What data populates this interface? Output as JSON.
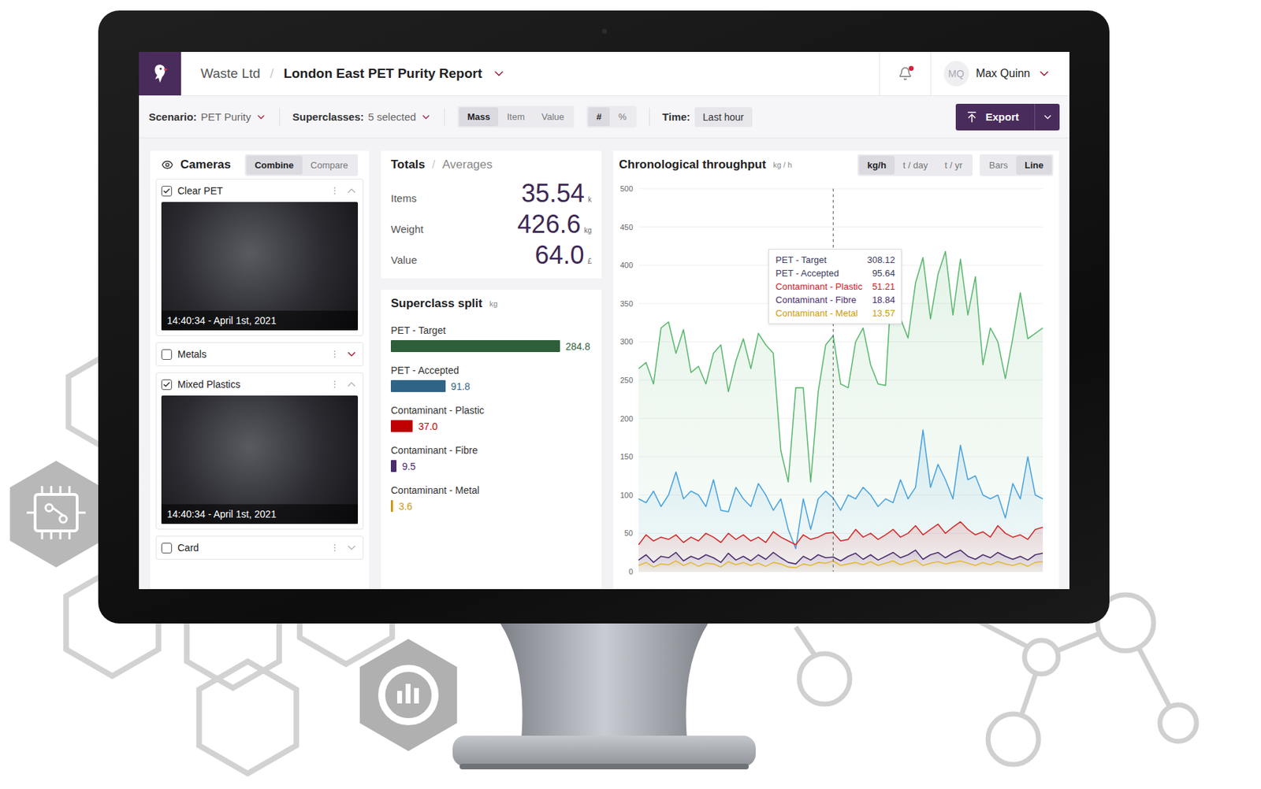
{
  "app": {
    "company": "Waste Ltd",
    "separator": "/",
    "report": "London East PET Purity Report"
  },
  "user": {
    "initials": "MQ",
    "name": "Max Quinn",
    "notifications": true
  },
  "toolbar": {
    "scenario": {
      "label": "Scenario:",
      "value": "PET Purity"
    },
    "superclasses": {
      "label": "Superclasses:",
      "value": "5 selected"
    },
    "measure": [
      {
        "label": "Mass",
        "selected": true
      },
      {
        "label": "Item",
        "selected": false
      },
      {
        "label": "Value",
        "selected": false
      }
    ],
    "unit": [
      {
        "label": "#",
        "selected": true
      },
      {
        "label": "%",
        "selected": false
      }
    ],
    "time": {
      "label": "Time:",
      "value": "Last hour"
    },
    "export": "Export"
  },
  "cameras": {
    "title": "Cameras",
    "modes": [
      {
        "label": "Combine",
        "selected": true
      },
      {
        "label": "Compare",
        "selected": false
      }
    ],
    "items": [
      {
        "name": "Clear PET",
        "checked": true,
        "expanded": true,
        "hovered": false,
        "timestamp": "14:40:34 - April 1st, 2021"
      },
      {
        "name": "Metals",
        "checked": false,
        "expanded": false,
        "hovered": true
      },
      {
        "name": "Mixed Plastics",
        "checked": true,
        "expanded": true,
        "hovered": false,
        "timestamp": "14:40:34 - April 1st, 2021"
      },
      {
        "name": "Card",
        "checked": false,
        "expanded": false,
        "hovered": false
      }
    ]
  },
  "totals": {
    "tabs": [
      {
        "label": "Totals",
        "selected": true
      },
      {
        "label": "Averages",
        "selected": false
      }
    ],
    "separator": "/",
    "rows": [
      {
        "label": "Items",
        "value": "35.54",
        "unit": "k"
      },
      {
        "label": "Weight",
        "value": "426.6",
        "unit": "kg"
      },
      {
        "label": "Value",
        "value": "64.0",
        "unit": "£"
      }
    ]
  },
  "split": {
    "title": "Superclass split",
    "unit": "kg",
    "items": [
      {
        "label": "PET - Target",
        "value": "284.8",
        "level": 1,
        "color": "#2e5e3a"
      },
      {
        "label": "PET - Accepted",
        "value": "91.8",
        "level": 0.322,
        "color": "#2f6486"
      },
      {
        "label": "Contaminant - Plastic",
        "value": "37.0",
        "level": 0.13,
        "color": "#c00000"
      },
      {
        "label": "Contaminant - Fibre",
        "value": "9.5",
        "level": 0.033,
        "color": "#4b2c6e"
      },
      {
        "label": "Contaminant - Metal",
        "value": "3.6",
        "level": 0.013,
        "color": "#c99a12"
      }
    ]
  },
  "chart": {
    "title": "Chronological throughput",
    "unit": "kg / h",
    "scales": [
      {
        "label": "kg/h",
        "selected": true
      },
      {
        "label": "t / day",
        "selected": false
      },
      {
        "label": "t / yr",
        "selected": false
      }
    ],
    "types": [
      {
        "label": "Bars",
        "selected": false
      },
      {
        "label": "Line",
        "selected": true
      }
    ],
    "ticks": [
      "500",
      "450",
      "400",
      "350",
      "300",
      "250",
      "200",
      "150",
      "100",
      "50",
      "0"
    ],
    "hover_index": 26,
    "tooltip": [
      {
        "name": "PET - Target",
        "value": "308.12",
        "color": "#3b3b5c"
      },
      {
        "name": "PET - Accepted",
        "value": "95.64",
        "color": "#3b3b5c"
      },
      {
        "name": "Contaminant - Plastic",
        "value": "51.21",
        "color": "#c81e2a"
      },
      {
        "name": "Contaminant - Fibre",
        "value": "18.84",
        "color": "#4b2c6e"
      },
      {
        "name": "Contaminant - Metal",
        "value": "13.57",
        "color": "#c99a12"
      }
    ],
    "series": [
      {
        "name": "PET - Target",
        "color": "#5cb870",
        "values": [
          265,
          273,
          245,
          318,
          326,
          285,
          316,
          260,
          268,
          245,
          285,
          296,
          235,
          275,
          304,
          265,
          311,
          296,
          285,
          158,
          117,
          240,
          240,
          117,
          235,
          296,
          308,
          245,
          240,
          300,
          318,
          270,
          245,
          243,
          408,
          330,
          305,
          377,
          410,
          330,
          388,
          418,
          335,
          408,
          335,
          385,
          270,
          318,
          300,
          252,
          305,
          364,
          304,
          311,
          318
        ]
      },
      {
        "name": "PET - Accepted",
        "color": "#4aa3df",
        "values": [
          95,
          90,
          105,
          85,
          100,
          130,
          95,
          105,
          100,
          85,
          120,
          80,
          78,
          110,
          95,
          85,
          115,
          100,
          80,
          95,
          55,
          30,
          95,
          55,
          95,
          105,
          96,
          80,
          100,
          95,
          110,
          100,
          85,
          95,
          90,
          120,
          95,
          110,
          185,
          110,
          140,
          120,
          95,
          165,
          120,
          125,
          100,
          95,
          100,
          70,
          115,
          95,
          150,
          100,
          95
        ]
      },
      {
        "name": "Contaminant - Plastic",
        "color": "#d42a2a",
        "values": [
          35,
          48,
          40,
          45,
          42,
          48,
          38,
          45,
          40,
          50,
          45,
          38,
          50,
          42,
          48,
          40,
          45,
          38,
          52,
          45,
          40,
          35,
          48,
          42,
          45,
          50,
          51,
          40,
          42,
          55,
          45,
          50,
          42,
          48,
          55,
          45,
          50,
          60,
          48,
          55,
          62,
          50,
          58,
          65,
          55,
          48,
          52,
          45,
          60,
          50,
          45,
          48,
          42,
          55,
          58
        ]
      },
      {
        "name": "Contaminant - Fibre",
        "color": "#4b2c6e",
        "values": [
          15,
          22,
          12,
          20,
          18,
          25,
          14,
          20,
          16,
          22,
          18,
          12,
          24,
          15,
          20,
          14,
          22,
          16,
          25,
          18,
          12,
          10,
          20,
          15,
          22,
          18,
          19,
          14,
          20,
          24,
          16,
          22,
          15,
          20,
          25,
          18,
          22,
          28,
          16,
          22,
          25,
          18,
          24,
          28,
          20,
          16,
          22,
          18,
          25,
          20,
          16,
          20,
          15,
          22,
          24
        ]
      },
      {
        "name": "Contaminant - Metal",
        "color": "#e2b93b",
        "values": [
          8,
          12,
          6,
          10,
          9,
          14,
          8,
          12,
          7,
          11,
          10,
          6,
          13,
          9,
          12,
          8,
          11,
          7,
          12,
          10,
          6,
          5,
          10,
          8,
          12,
          11,
          14,
          8,
          10,
          12,
          9,
          13,
          8,
          11,
          14,
          9,
          12,
          15,
          8,
          11,
          13,
          10,
          12,
          14,
          11,
          8,
          12,
          9,
          13,
          10,
          8,
          11,
          7,
          12,
          13
        ]
      }
    ]
  }
}
